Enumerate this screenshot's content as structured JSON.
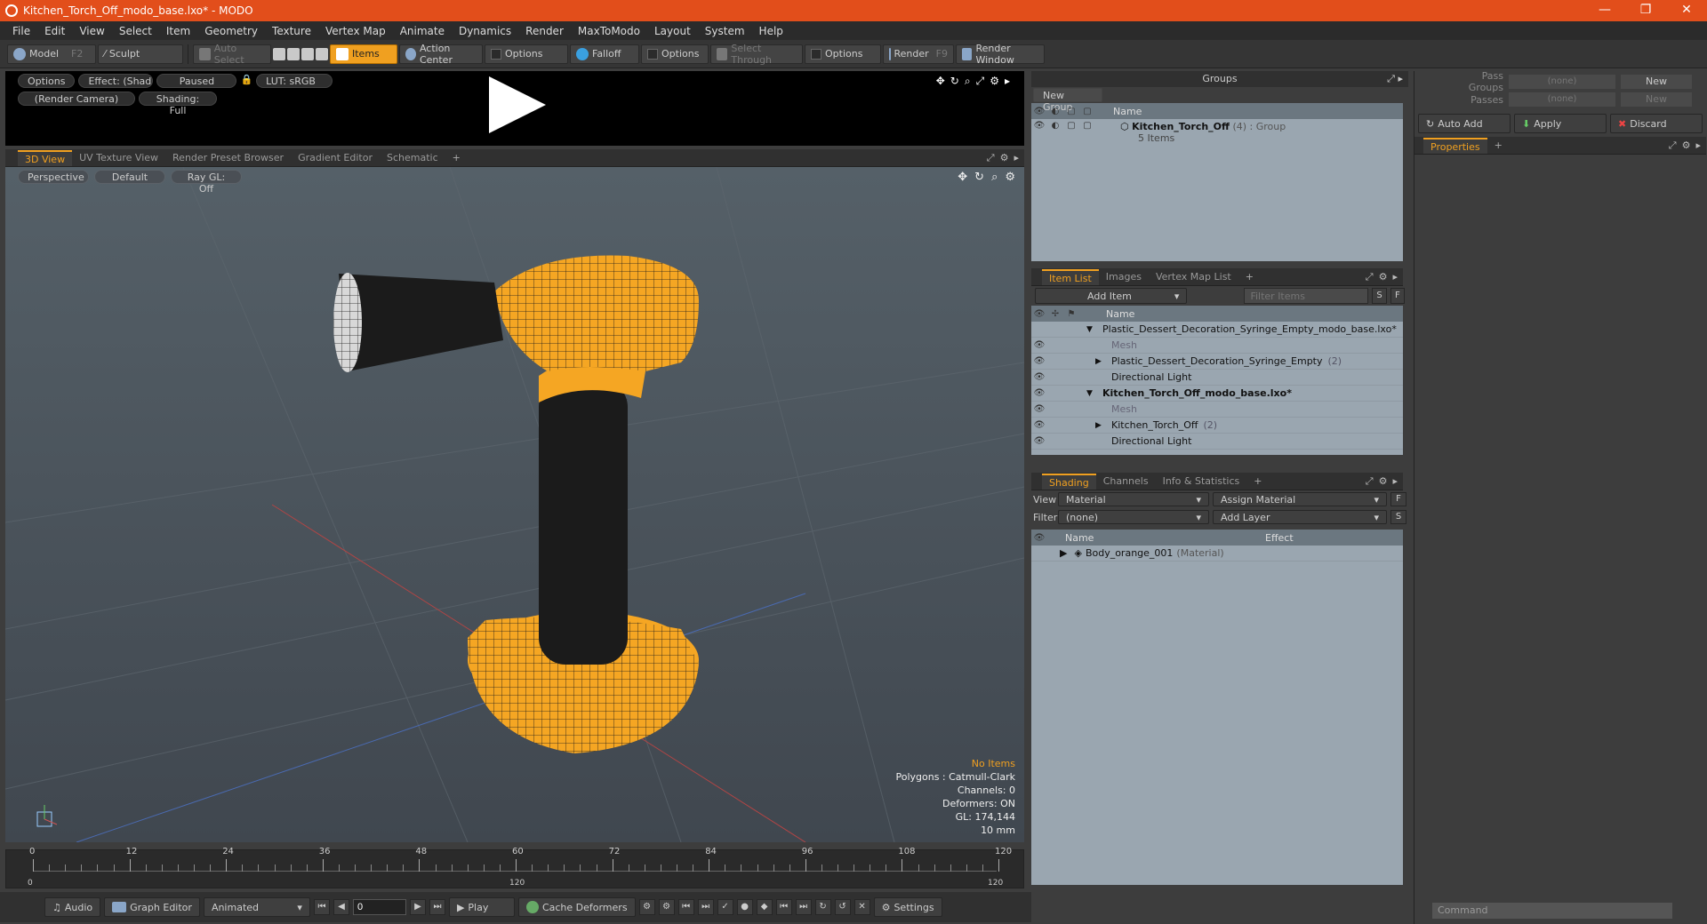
{
  "window": {
    "title": "Kitchen_Torch_Off_modo_base.lxo* - MODO"
  },
  "menu": [
    "File",
    "Edit",
    "View",
    "Select",
    "Item",
    "Geometry",
    "Texture",
    "Vertex Map",
    "Animate",
    "Dynamics",
    "Render",
    "MaxToModo",
    "Layout",
    "System",
    "Help"
  ],
  "toolbar": {
    "model": "Model",
    "model_key": "F2",
    "sculpt": "Sculpt",
    "auto_select": "Auto Select",
    "items": "Items",
    "action_center": "Action Center",
    "options": "Options",
    "falloff": "Falloff",
    "select_through": "Select Through",
    "render": "Render",
    "render_key": "F9",
    "render_window": "Render Window"
  },
  "preview": {
    "options": "Options",
    "effect": "Effect: (Shadi...",
    "paused": "Paused",
    "lut": "LUT: sRGB",
    "camera": "(Render Camera)",
    "shading": "Shading: Full"
  },
  "view_tabs": [
    "3D View",
    "UV Texture View",
    "Render Preset Browser",
    "Gradient Editor",
    "Schematic"
  ],
  "viewport": {
    "perspective": "Perspective",
    "default": "Default",
    "raygl": "Ray GL: Off",
    "stats": {
      "items": "No Items",
      "polygons": "Polygons : Catmull-Clark",
      "channels": "Channels: 0",
      "deformers": "Deformers: ON",
      "gl": "GL: 174,144",
      "scale": "10 mm"
    }
  },
  "timeline": {
    "labels": [
      "0",
      "12",
      "24",
      "36",
      "48",
      "60",
      "72",
      "84",
      "96",
      "108",
      "120"
    ],
    "start": "0",
    "end_mid": "120",
    "end": "120"
  },
  "bottom": {
    "audio": "Audio",
    "graph": "Graph Editor",
    "animated": "Animated",
    "frame": "0",
    "play": "Play",
    "cache": "Cache Deformers",
    "settings": "Settings"
  },
  "groups": {
    "title": "Groups",
    "new_group": "New Group",
    "col_name": "Name",
    "item_name": "Kitchen_Torch_Off",
    "item_count": "(4)",
    "item_type": ": Group",
    "item_sub": "5 Items"
  },
  "item_tabs": [
    "Item List",
    "Images",
    "Vertex Map List"
  ],
  "item_list": {
    "add_item": "Add Item",
    "filter": "Filter Items",
    "s": "S",
    "f": "F",
    "col_name": "Name",
    "rows": [
      {
        "label": "Plastic_Dessert_Decoration_Syringe_Empty_modo_base.lxo*",
        "indent": 0,
        "bold": false,
        "eye": false,
        "expander": "▼"
      },
      {
        "label": "Mesh",
        "indent": 1,
        "bold": false,
        "eye": true,
        "dim": true,
        "expander": ""
      },
      {
        "label": "Plastic_Dessert_Decoration_Syringe_Empty",
        "extra": "(2)",
        "indent": 1,
        "bold": false,
        "eye": true,
        "expander": "▶"
      },
      {
        "label": "Directional Light",
        "indent": 1,
        "bold": false,
        "eye": true,
        "expander": ""
      },
      {
        "label": "Kitchen_Torch_Off_modo_base.lxo*",
        "indent": 0,
        "bold": true,
        "eye": true,
        "expander": "▼"
      },
      {
        "label": "Mesh",
        "indent": 1,
        "bold": false,
        "eye": true,
        "dim": true,
        "expander": ""
      },
      {
        "label": "Kitchen_Torch_Off",
        "extra": "(2)",
        "indent": 1,
        "bold": false,
        "eye": true,
        "expander": "▶"
      },
      {
        "label": "Directional Light",
        "indent": 1,
        "bold": false,
        "eye": true,
        "expander": ""
      }
    ]
  },
  "shading_tabs": [
    "Shading",
    "Channels",
    "Info & Statistics"
  ],
  "shading": {
    "view_lbl": "View",
    "view_val": "Material",
    "assign": "Assign Material",
    "f": "F",
    "filter_lbl": "Filter",
    "filter_val": "(none)",
    "add_layer": "Add Layer",
    "s": "S",
    "col_name": "Name",
    "col_effect": "Effect",
    "row": "Body_orange_001",
    "row_type": "(Material)"
  },
  "pass": {
    "groups_lbl": "Pass Groups",
    "groups_val": "(none)",
    "passes_lbl": "Passes",
    "passes_val": "(none)",
    "new": "New",
    "new2": "New",
    "auto_add": "Auto Add",
    "apply": "Apply",
    "discard": "Discard"
  },
  "properties": {
    "tab": "Properties",
    "command": "Command"
  }
}
